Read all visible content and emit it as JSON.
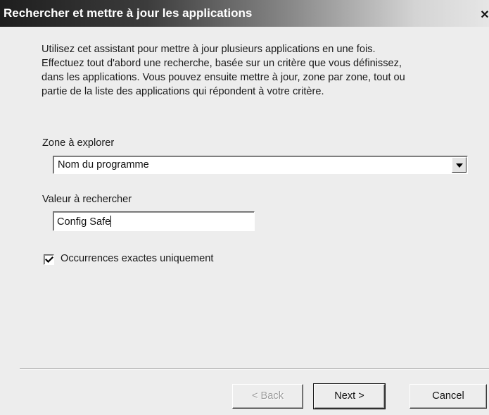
{
  "window": {
    "title": "Rechercher et mettre à jour les applications",
    "close_glyph": "✕"
  },
  "intro": {
    "lines": [
      "Utilisez cet assistant pour mettre à jour plusieurs applications en une fois.",
      "Effectuez tout d'abord une recherche, basée sur un critère que vous définissez,",
      "dans les applications. Vous pouvez ensuite mettre à jour, zone par zone, tout ou",
      "partie de la liste des applications qui répondent à  votre critère."
    ]
  },
  "search_zone": {
    "label": "Zone à explorer",
    "selected": "Nom du programme"
  },
  "search_value": {
    "label": "Valeur à rechercher",
    "value": "Config Safe"
  },
  "exact_match": {
    "label": "Occurrences exactes uniquement",
    "checked": true
  },
  "buttons": {
    "back": "< Back",
    "next": "Next >",
    "cancel": "Cancel"
  },
  "icons": {
    "close": "close-icon",
    "dropdown": "chevron-down-icon",
    "checkmark": "checkmark-icon"
  }
}
